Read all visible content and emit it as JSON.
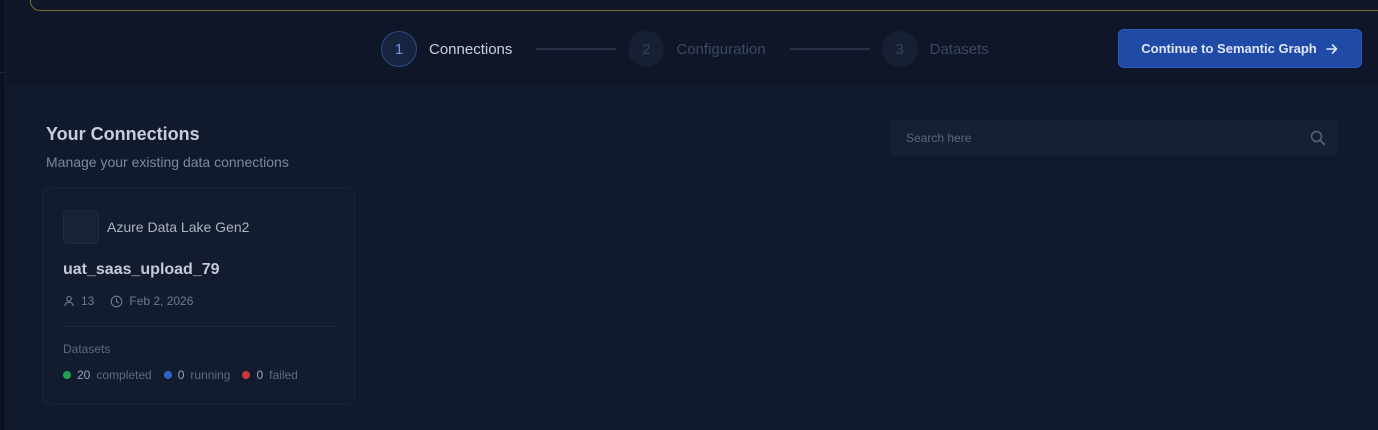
{
  "stepper": {
    "steps": [
      {
        "number": "1",
        "label": "Connections",
        "state": "active"
      },
      {
        "number": "2",
        "label": "Configuration",
        "state": "inactive"
      },
      {
        "number": "3",
        "label": "Datasets",
        "state": "inactive"
      }
    ]
  },
  "header": {
    "cta_label": "Continue to Semantic Graph",
    "cta_icon": "arrow-right-icon"
  },
  "main": {
    "title": "Your Connections",
    "subtitle": "Manage your existing data connections",
    "search": {
      "placeholder": "Search here",
      "icon": "search-icon"
    }
  },
  "connection_card": {
    "source_type": "Azure Data Lake Gen2",
    "name": "uat_saas_upload_79",
    "users_count": "13",
    "date": "Feb 2, 2026",
    "datasets_label": "Datasets",
    "stats": [
      {
        "count": "20",
        "label": "completed",
        "color": "#22a150"
      },
      {
        "count": "0",
        "label": "running",
        "color": "#2f63c9"
      },
      {
        "count": "0",
        "label": "failed",
        "color": "#c53a3a"
      }
    ]
  }
}
